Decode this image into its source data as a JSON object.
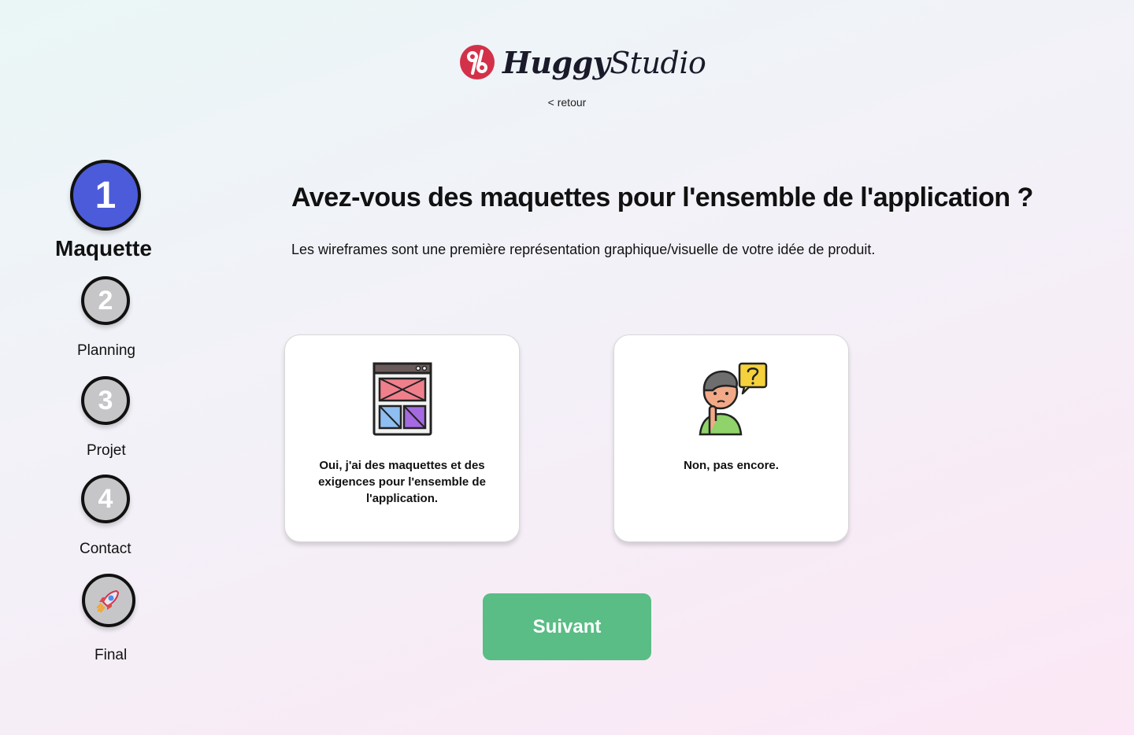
{
  "header": {
    "logo_bold": "Huggy",
    "logo_light": "Studio",
    "back_label": "< retour"
  },
  "stepper": {
    "steps": [
      {
        "number": "1",
        "label": "Maquette",
        "state": "active"
      },
      {
        "number": "2",
        "label": "Planning",
        "state": "idle"
      },
      {
        "number": "3",
        "label": "Projet",
        "state": "idle"
      },
      {
        "number": "4",
        "label": "Contact",
        "state": "idle"
      },
      {
        "icon": "rocket-icon",
        "label": "Final",
        "state": "idle"
      }
    ]
  },
  "main": {
    "question": "Avez-vous des maquettes pour l'ensemble de l'application ?",
    "subtitle": "Les wireframes sont une première représentation graphique/visuelle de votre idée de produit.",
    "options": [
      {
        "icon": "wireframe-icon",
        "text": "Oui, j'ai des maquettes et des exigences pour l'ensemble de l'application."
      },
      {
        "icon": "thinking-person-icon",
        "text": "Non, pas encore."
      }
    ],
    "next_label": "Suivant"
  },
  "colors": {
    "brand_red": "#d3314a",
    "active_step": "#4b5bd9",
    "idle_step": "#c6c6c8",
    "primary_button": "#59bd85"
  }
}
